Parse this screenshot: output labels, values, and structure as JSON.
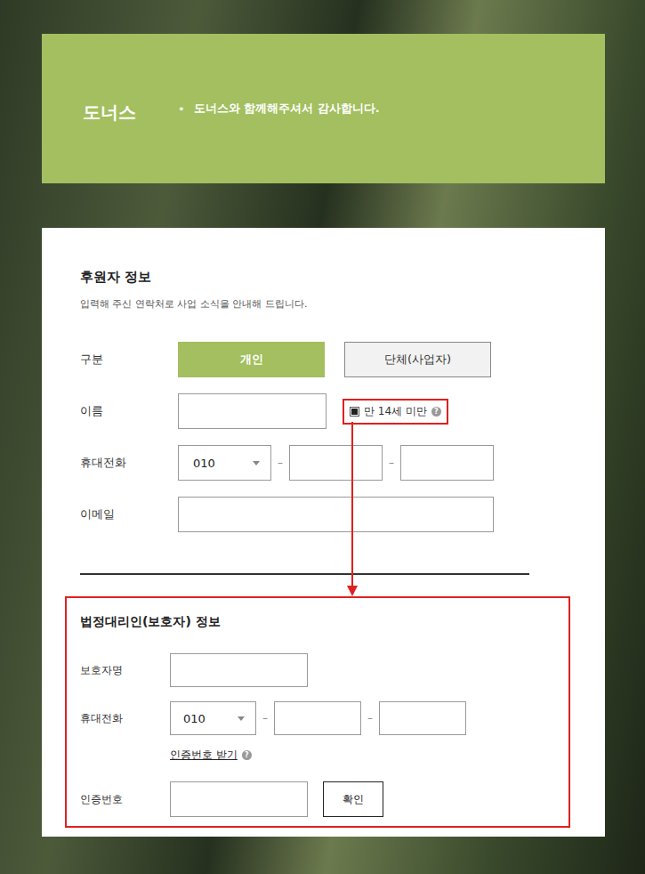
{
  "header": {
    "brand": "도너스",
    "bullet": "•",
    "message": "도너스와 함께해주셔서 감사합니다."
  },
  "donor": {
    "title": "후원자 정보",
    "subtitle": "입력해 주신 연락처로 사업 소식을 안내해 드립니다.",
    "type_label": "구분",
    "types": [
      {
        "label": "개인",
        "selected": true
      },
      {
        "label": "단체(사업자)",
        "selected": false
      }
    ],
    "name_label": "이름",
    "under14": {
      "label": "만 14세 미만",
      "checked": true,
      "help": "?"
    },
    "phone_label": "휴대전화",
    "phone_prefix": "010",
    "phone_separator": "–",
    "email_label": "이메일"
  },
  "guardian": {
    "title": "법정대리인(보호자) 정보",
    "name_label": "보호자명",
    "phone_label": "휴대전화",
    "phone_prefix": "010",
    "phone_separator": "–",
    "verify_link": "인증번호 받기",
    "verify_help": "?",
    "code_label": "인증번호",
    "confirm_button": "확인"
  }
}
